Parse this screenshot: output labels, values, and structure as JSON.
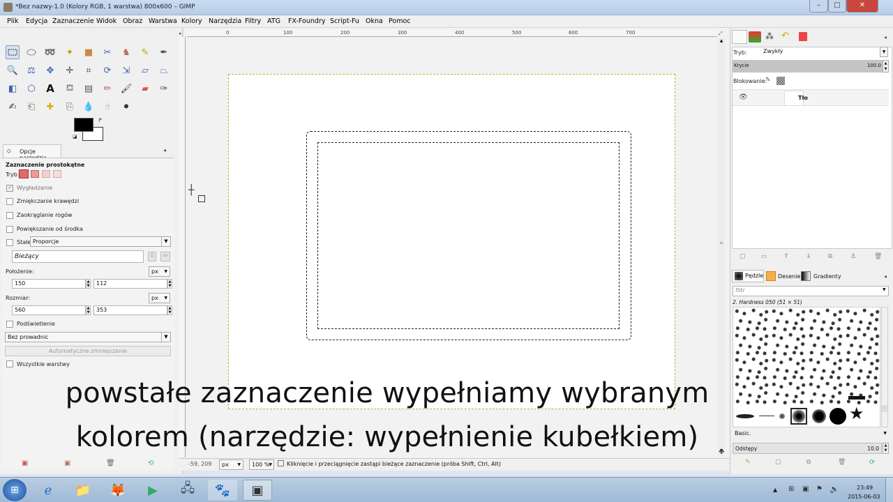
{
  "window": {
    "title": "*Bez nazwy-1.0 (Kolory RGB, 1 warstwa) 800x600 – GIMP"
  },
  "menu": [
    "Plik",
    "Edycja",
    "Zaznaczenie",
    "Widok",
    "Obraz",
    "Warstwa",
    "Kolory",
    "Narzędzia",
    "Filtry",
    "ATG",
    "FX-Foundry",
    "Script-Fu",
    "Okna",
    "Pomoc"
  ],
  "tool_options": {
    "tab": "Opcje narzędzia",
    "title": "Zaznaczenie prostokątne",
    "mode_label": "Tryb:",
    "antialias": "Wygładzanie",
    "feather": "Zmiękczanie krawędzi",
    "round": "Zaokrąglanie rogów",
    "expand": "Powiększanie od środka",
    "fixed": "Stałe:",
    "fixed_value": "Proporcje",
    "current": "Bieżący",
    "position_label": "Położenie:",
    "pos_unit": "px",
    "pos_x": "150",
    "pos_y": "112",
    "size_label": "Rozmiar:",
    "size_unit": "px",
    "size_w": "560",
    "size_h": "353",
    "highlight": "Podświetlenie",
    "guides": "Bez prowadnic",
    "autoshrink": "Automatyczne zmniejszanie",
    "all_layers": "Wszystkie warstwy"
  },
  "ruler_h": [
    "0",
    "100",
    "200",
    "300",
    "400",
    "500",
    "600",
    "700"
  ],
  "status": {
    "coords": "-59, 209",
    "unit": "px",
    "zoom": "100 %",
    "message": "Kliknięcie i przeciągnięcie zastąpi bieżące zaznaczenie (próba Shift, Ctrl, Alt)"
  },
  "layers": {
    "mode_label": "Tryb:",
    "mode_value": "Zwykły",
    "opacity_label": "Krycie",
    "opacity_value": "100.0",
    "lock_label": "Blokowanie:",
    "layer_name": "Tło"
  },
  "brushes": {
    "tabs": [
      "Pędzle",
      "Desenie",
      "Gradienty"
    ],
    "filter_placeholder": "filtr",
    "current": "2. Hardness 050 (51 × 51)",
    "preset": "Basic.",
    "spacing_label": "Odstępy",
    "spacing_value": "10.0"
  },
  "subtitles": [
    "powstałe zaznaczenie wypełniamy wybranym",
    "kolorem (narzędzie: wypełnienie kubełkiem)"
  ],
  "taskbar": {
    "time": "23:49",
    "date": "2015-06-03"
  }
}
